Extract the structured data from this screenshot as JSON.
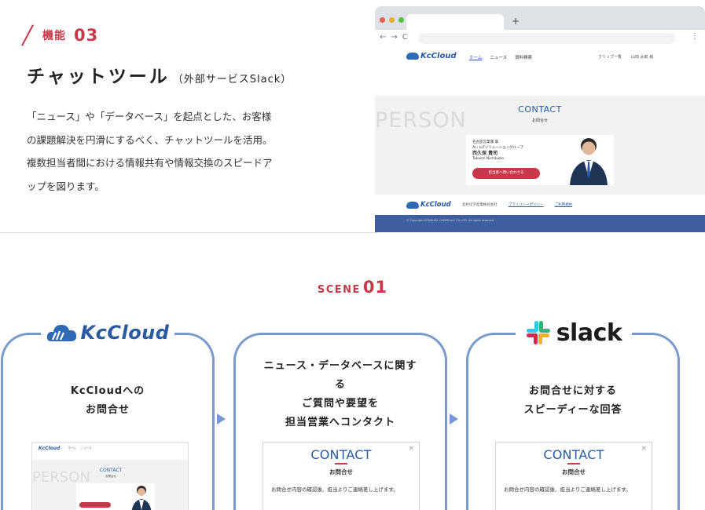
{
  "feature": {
    "label": "機能",
    "number": "03",
    "title": "チャットツール",
    "title_sub": "（外部サービスSlack）",
    "description": [
      "「ニュース」や「データベース」を起点とした、お客様",
      "の課題解決を円滑にするべく、チャットツールを活用。",
      "複数担当者間における情報共有や情報交換のスピードア",
      "ップを図ります。"
    ]
  },
  "browser": {
    "new_tab": "+",
    "nav_icons": "←→C",
    "menu_icon": "⋮",
    "site": {
      "logo": "KcCloud",
      "nav": [
        "ホーム",
        "ニュース",
        "資料検索"
      ],
      "right": [
        "クリップ一覧",
        "山田 太郎 様"
      ],
      "bg_word": "PERSON",
      "contact_title": "CONTACT",
      "contact_sub": "お問合せ",
      "card": {
        "dept": "名古屋営業課 兼",
        "group": "AI・IoTソリューショングループ",
        "name": "西久保 貴司",
        "romaji": "Takashi Nishikubo",
        "button": "担当者へ問い合わせる"
      },
      "footer_company": "北村化学産業株式会社",
      "footer_links": [
        "プライバシーポリシー",
        "ご利用規約"
      ],
      "copyright": "© Copyright KITAMURA CHEMICALS CO.,LTD. All rights reserved."
    }
  },
  "scene": {
    "label": "SCENE",
    "number": "01",
    "steps": [
      {
        "badge": "KcCloud",
        "text": [
          "KcCloudへの",
          "お問合せ"
        ]
      },
      {
        "text": [
          "ニュース・データベースに関す",
          "る",
          "ご質問や要望を",
          "担当営業へコンタクト"
        ]
      },
      {
        "badge": "slack",
        "text": [
          "お問合せに対する",
          "スピーディーな回答"
        ]
      }
    ],
    "dialog": {
      "title": "CONTACT",
      "sub": "お問合せ",
      "body": "お問合せ内容の確認後、担当よりご連絡差し上げます。",
      "close": "×"
    }
  },
  "colors": {
    "accent": "#c8384a",
    "brand_blue": "#2a5aa0",
    "frame": "#7a99cc"
  }
}
